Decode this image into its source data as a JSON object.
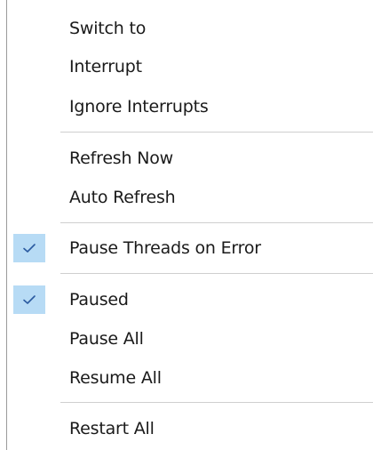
{
  "menu": {
    "items": [
      {
        "label": "Switch to",
        "checked": false
      },
      {
        "label": "Interrupt",
        "checked": false
      },
      {
        "label": "Ignore Interrupts",
        "checked": false
      },
      {
        "label": "Refresh Now",
        "checked": false
      },
      {
        "label": "Auto Refresh",
        "checked": false
      },
      {
        "label": "Pause Threads on Error",
        "checked": true
      },
      {
        "label": "Paused",
        "checked": true
      },
      {
        "label": "Pause All",
        "checked": false
      },
      {
        "label": "Resume All",
        "checked": false
      },
      {
        "label": "Restart All",
        "checked": false
      }
    ],
    "check_icon": "checkmark-icon",
    "check_background": "#b7dbf5",
    "check_color": "#2a5aa0"
  }
}
